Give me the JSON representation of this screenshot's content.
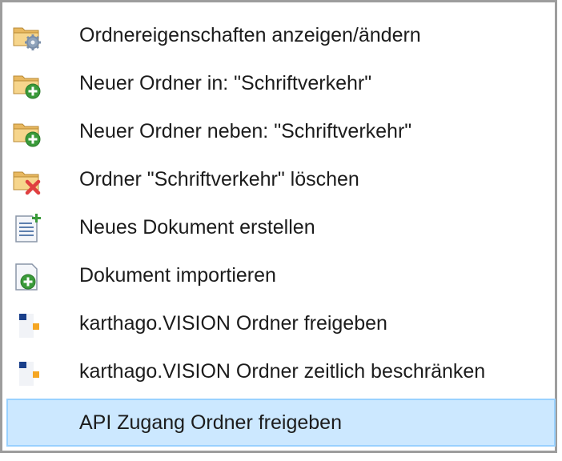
{
  "context_menu": {
    "items": [
      {
        "label": "Ordnereigenschaften anzeigen/ändern",
        "icon": "folder-settings-icon"
      },
      {
        "label": "Neuer Ordner in: \"Schriftverkehr\"",
        "icon": "folder-add-icon"
      },
      {
        "label": "Neuer Ordner neben: \"Schriftverkehr\"",
        "icon": "folder-add-icon"
      },
      {
        "label": "Ordner \"Schriftverkehr\" löschen",
        "icon": "folder-delete-icon"
      },
      {
        "label": "Neues Dokument erstellen",
        "icon": "new-document-icon"
      },
      {
        "label": "Dokument importieren",
        "icon": "document-import-icon"
      },
      {
        "label": "karthago.VISION Ordner freigeben",
        "icon": "karthago-vision-icon"
      },
      {
        "label": "karthago.VISION Ordner zeitlich beschränken",
        "icon": "karthago-vision-icon"
      },
      {
        "label": "API Zugang Ordner freigeben",
        "icon": ""
      }
    ],
    "selected_index": 8,
    "colors": {
      "selection_background": "#cce8ff",
      "selection_border": "#99d1ff",
      "folder": "#e8b860",
      "add_green": "#3a9a3a",
      "delete_red": "#e04040",
      "karthago_blue": "#1a3f8a",
      "karthago_orange": "#f5a623"
    }
  }
}
